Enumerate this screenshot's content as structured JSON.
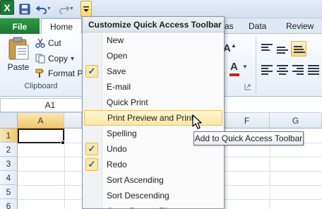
{
  "quick_access": {
    "customize_menu_title": "Customize Quick Access Toolbar"
  },
  "app_icon_letter": "X",
  "tabs": {
    "file": "File",
    "home": "Home",
    "partial_data": "as",
    "data": "Data",
    "review": "Review"
  },
  "clipboard": {
    "paste": "Paste",
    "cut": "Cut",
    "copy": "Copy",
    "copy_caret": "▾",
    "format_painter": "Format Pa",
    "group_label": "Clipboard"
  },
  "formula_bar": {
    "name_box": "A1"
  },
  "grid": {
    "columns": [
      "A",
      "F",
      "G"
    ],
    "rows": [
      "1",
      "2",
      "3",
      "4",
      "5",
      "6"
    ]
  },
  "menu": {
    "items": [
      {
        "label": "New",
        "checked": false
      },
      {
        "label": "Open",
        "checked": false
      },
      {
        "label": "Save",
        "checked": true
      },
      {
        "label": "E-mail",
        "checked": false
      },
      {
        "label": "Quick Print",
        "checked": false
      },
      {
        "label": "Print Preview and Print",
        "checked": false,
        "hover": true
      },
      {
        "label": "Spelling",
        "checked": false
      },
      {
        "label": "Undo",
        "checked": true
      },
      {
        "label": "Redo",
        "checked": true
      },
      {
        "label": "Sort Ascending",
        "checked": false
      },
      {
        "label": "Sort Descending",
        "checked": false
      },
      {
        "label": "Open Recent File",
        "checked": false
      }
    ]
  },
  "tooltip": "Add to Quick Access Toolbar",
  "colors": {
    "file_tab": "#2f9a44",
    "highlight": "#fde7a2",
    "font_color_bar": "#d0201f",
    "check_mark": "#1f5fb0"
  }
}
